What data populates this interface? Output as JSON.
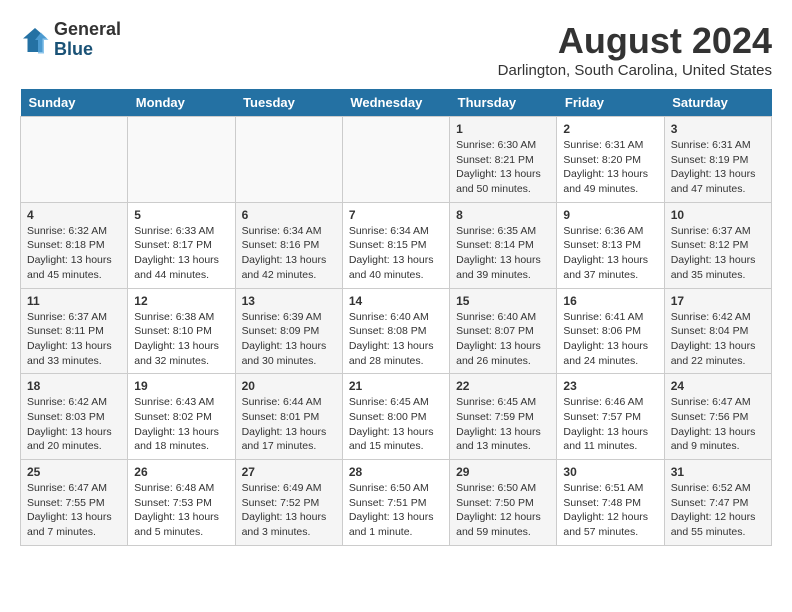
{
  "header": {
    "logo_general": "General",
    "logo_blue": "Blue",
    "month_year": "August 2024",
    "location": "Darlington, South Carolina, United States"
  },
  "days_of_week": [
    "Sunday",
    "Monday",
    "Tuesday",
    "Wednesday",
    "Thursday",
    "Friday",
    "Saturday"
  ],
  "weeks": [
    [
      {
        "day": "",
        "info": ""
      },
      {
        "day": "",
        "info": ""
      },
      {
        "day": "",
        "info": ""
      },
      {
        "day": "",
        "info": ""
      },
      {
        "day": "1",
        "info": "Sunrise: 6:30 AM\nSunset: 8:21 PM\nDaylight: 13 hours\nand 50 minutes."
      },
      {
        "day": "2",
        "info": "Sunrise: 6:31 AM\nSunset: 8:20 PM\nDaylight: 13 hours\nand 49 minutes."
      },
      {
        "day": "3",
        "info": "Sunrise: 6:31 AM\nSunset: 8:19 PM\nDaylight: 13 hours\nand 47 minutes."
      }
    ],
    [
      {
        "day": "4",
        "info": "Sunrise: 6:32 AM\nSunset: 8:18 PM\nDaylight: 13 hours\nand 45 minutes."
      },
      {
        "day": "5",
        "info": "Sunrise: 6:33 AM\nSunset: 8:17 PM\nDaylight: 13 hours\nand 44 minutes."
      },
      {
        "day": "6",
        "info": "Sunrise: 6:34 AM\nSunset: 8:16 PM\nDaylight: 13 hours\nand 42 minutes."
      },
      {
        "day": "7",
        "info": "Sunrise: 6:34 AM\nSunset: 8:15 PM\nDaylight: 13 hours\nand 40 minutes."
      },
      {
        "day": "8",
        "info": "Sunrise: 6:35 AM\nSunset: 8:14 PM\nDaylight: 13 hours\nand 39 minutes."
      },
      {
        "day": "9",
        "info": "Sunrise: 6:36 AM\nSunset: 8:13 PM\nDaylight: 13 hours\nand 37 minutes."
      },
      {
        "day": "10",
        "info": "Sunrise: 6:37 AM\nSunset: 8:12 PM\nDaylight: 13 hours\nand 35 minutes."
      }
    ],
    [
      {
        "day": "11",
        "info": "Sunrise: 6:37 AM\nSunset: 8:11 PM\nDaylight: 13 hours\nand 33 minutes."
      },
      {
        "day": "12",
        "info": "Sunrise: 6:38 AM\nSunset: 8:10 PM\nDaylight: 13 hours\nand 32 minutes."
      },
      {
        "day": "13",
        "info": "Sunrise: 6:39 AM\nSunset: 8:09 PM\nDaylight: 13 hours\nand 30 minutes."
      },
      {
        "day": "14",
        "info": "Sunrise: 6:40 AM\nSunset: 8:08 PM\nDaylight: 13 hours\nand 28 minutes."
      },
      {
        "day": "15",
        "info": "Sunrise: 6:40 AM\nSunset: 8:07 PM\nDaylight: 13 hours\nand 26 minutes."
      },
      {
        "day": "16",
        "info": "Sunrise: 6:41 AM\nSunset: 8:06 PM\nDaylight: 13 hours\nand 24 minutes."
      },
      {
        "day": "17",
        "info": "Sunrise: 6:42 AM\nSunset: 8:04 PM\nDaylight: 13 hours\nand 22 minutes."
      }
    ],
    [
      {
        "day": "18",
        "info": "Sunrise: 6:42 AM\nSunset: 8:03 PM\nDaylight: 13 hours\nand 20 minutes."
      },
      {
        "day": "19",
        "info": "Sunrise: 6:43 AM\nSunset: 8:02 PM\nDaylight: 13 hours\nand 18 minutes."
      },
      {
        "day": "20",
        "info": "Sunrise: 6:44 AM\nSunset: 8:01 PM\nDaylight: 13 hours\nand 17 minutes."
      },
      {
        "day": "21",
        "info": "Sunrise: 6:45 AM\nSunset: 8:00 PM\nDaylight: 13 hours\nand 15 minutes."
      },
      {
        "day": "22",
        "info": "Sunrise: 6:45 AM\nSunset: 7:59 PM\nDaylight: 13 hours\nand 13 minutes."
      },
      {
        "day": "23",
        "info": "Sunrise: 6:46 AM\nSunset: 7:57 PM\nDaylight: 13 hours\nand 11 minutes."
      },
      {
        "day": "24",
        "info": "Sunrise: 6:47 AM\nSunset: 7:56 PM\nDaylight: 13 hours\nand 9 minutes."
      }
    ],
    [
      {
        "day": "25",
        "info": "Sunrise: 6:47 AM\nSunset: 7:55 PM\nDaylight: 13 hours\nand 7 minutes."
      },
      {
        "day": "26",
        "info": "Sunrise: 6:48 AM\nSunset: 7:53 PM\nDaylight: 13 hours\nand 5 minutes."
      },
      {
        "day": "27",
        "info": "Sunrise: 6:49 AM\nSunset: 7:52 PM\nDaylight: 13 hours\nand 3 minutes."
      },
      {
        "day": "28",
        "info": "Sunrise: 6:50 AM\nSunset: 7:51 PM\nDaylight: 13 hours\nand 1 minute."
      },
      {
        "day": "29",
        "info": "Sunrise: 6:50 AM\nSunset: 7:50 PM\nDaylight: 12 hours\nand 59 minutes."
      },
      {
        "day": "30",
        "info": "Sunrise: 6:51 AM\nSunset: 7:48 PM\nDaylight: 12 hours\nand 57 minutes."
      },
      {
        "day": "31",
        "info": "Sunrise: 6:52 AM\nSunset: 7:47 PM\nDaylight: 12 hours\nand 55 minutes."
      }
    ]
  ]
}
